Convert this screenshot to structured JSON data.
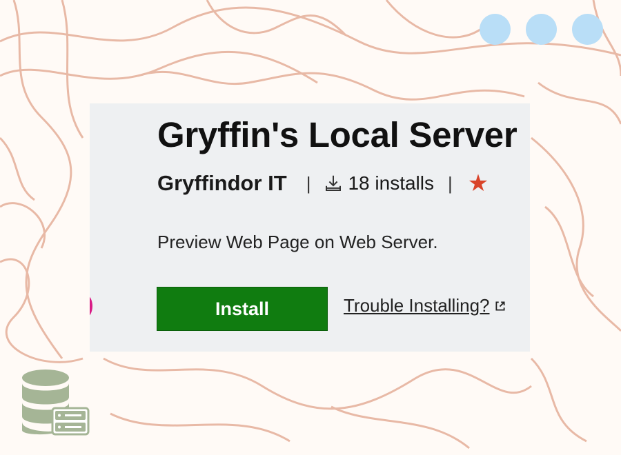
{
  "extension": {
    "title": "Gryffin's Local Server",
    "publisher": "Gryffindor IT",
    "separator": "|",
    "installs": "18 installs",
    "description": "Preview Web Page on Web Server."
  },
  "actions": {
    "install_label": "Install",
    "trouble_label": "Trouble Installing?"
  },
  "icons": {
    "download": "download-icon",
    "rating": "star-icon",
    "external": "external-link-icon",
    "logo": "database-server-icon"
  },
  "colors": {
    "install_bg": "#107c10",
    "star": "#d9442a",
    "background_lines": "#e8b9a6",
    "dots": "#b9def7",
    "card_bg": "#eef0f2",
    "logo": "#a5b596"
  }
}
